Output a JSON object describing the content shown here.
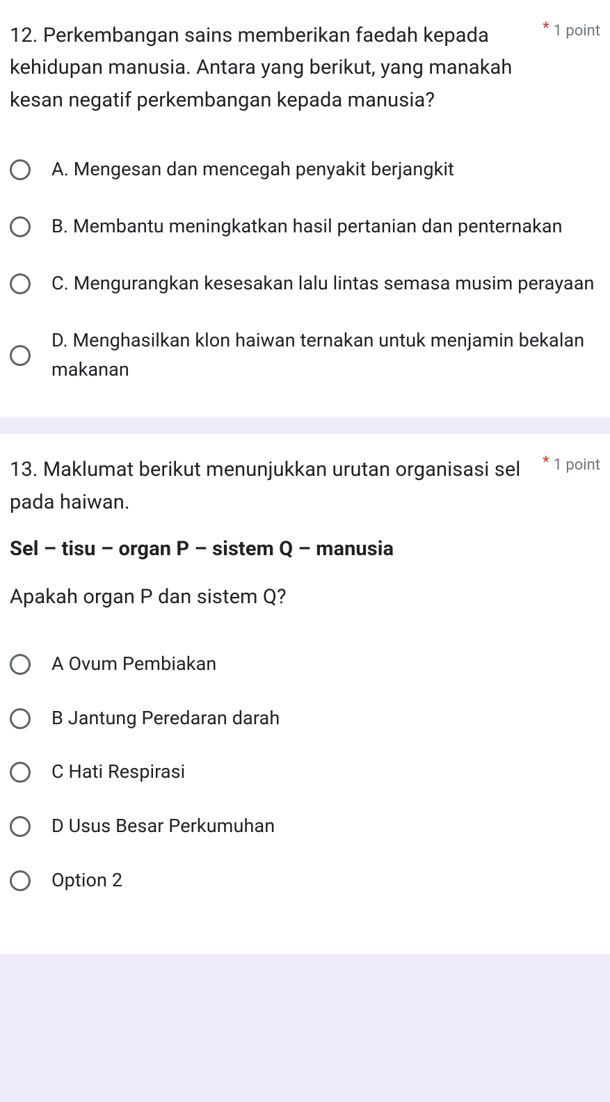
{
  "questions": [
    {
      "number": "12.",
      "text": "Perkembangan sains memberikan faedah kepada kehidupan manusia. Antara yang berikut, yang manakah kesan negatif perkembangan kepada manusia?",
      "required": "*",
      "points": "1 point",
      "options": [
        "A. Mengesan dan mencegah penyakit berjangkit",
        "B. Membantu meningkatkan hasil pertanian dan penternakan",
        "C. Mengurangkan kesesakan lalu lintas semasa musim perayaan",
        "D. Menghasilkan klon haiwan ternakan untuk menjamin bekalan makanan"
      ]
    },
    {
      "number": "13.",
      "text_line1": "Maklumat berikut menunjukkan urutan organisasi sel pada haiwan.",
      "bold_line": "Sel – tisu – organ P – sistem Q – manusia",
      "text_line2": "Apakah organ P dan sistem Q?",
      "required": "*",
      "points": "1 point",
      "options": [
        "A Ovum Pembiakan",
        "B Jantung  Peredaran darah",
        "C Hati     Respirasi",
        "D Usus Besar Perkumuhan",
        "Option 2"
      ]
    }
  ]
}
